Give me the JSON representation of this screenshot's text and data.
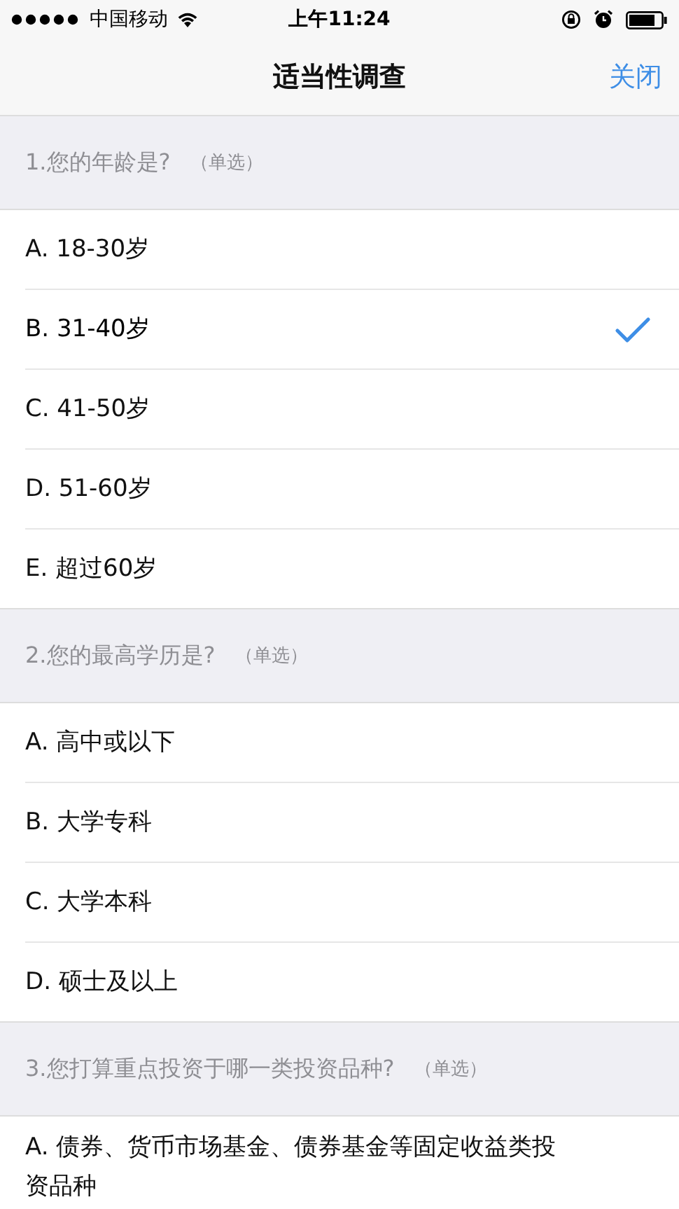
{
  "status_bar": {
    "carrier": "中国移动",
    "time": "上午11:24"
  },
  "nav": {
    "title": "适当性调查",
    "close": "关闭"
  },
  "questions": [
    {
      "title": "1.您的年龄是?",
      "hint": "（单选）",
      "options": [
        {
          "label": "A. 18-30岁",
          "selected": false
        },
        {
          "label": "B. 31-40岁",
          "selected": true
        },
        {
          "label": "C. 41-50岁",
          "selected": false
        },
        {
          "label": "D. 51-60岁",
          "selected": false
        },
        {
          "label": "E. 超过60岁",
          "selected": false
        }
      ]
    },
    {
      "title": "2.您的最高学历是?",
      "hint": "（单选）",
      "options": [
        {
          "label": "A. 高中或以下",
          "selected": false
        },
        {
          "label": "B. 大学专科",
          "selected": false
        },
        {
          "label": "C. 大学本科",
          "selected": false
        },
        {
          "label": "D. 硕士及以上",
          "selected": false
        }
      ]
    },
    {
      "title": "3.您打算重点投资于哪一类投资品种?",
      "hint": "（单选）",
      "options": [
        {
          "label": "A. 债券、货币市场基金、债券基金等固定收益类投资品种",
          "selected": false
        }
      ]
    }
  ]
}
